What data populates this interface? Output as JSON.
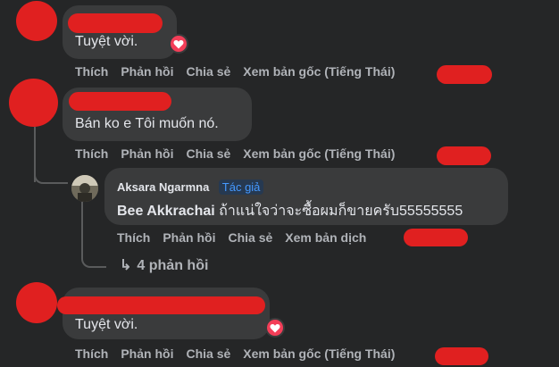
{
  "actions": {
    "like": "Thích",
    "reply": "Phản hồi",
    "share": "Chia sẻ",
    "see_original": "Xem bản gốc (Tiếng Thái)",
    "see_translation": "Xem bản dịch"
  },
  "comments": [
    {
      "text": "Tuyệt vời."
    },
    {
      "text": "Bán ko e Tôi muốn nó."
    },
    {
      "text": "Tuyệt vời."
    }
  ],
  "reply": {
    "author": "Aksara Ngarmna",
    "badge": "Tác giả",
    "mention": "Bee Akkrachai",
    "text": " ถ้าแน่ใจว่าจะซื้อผมก็ขายครับ55555555"
  },
  "replies_link": {
    "arrow": "↳",
    "label": "4 phản hồi"
  },
  "colors": {
    "background": "#252627",
    "bubble": "#3a3b3c",
    "heart": "#f33e58",
    "badge_text": "#4599ff",
    "redaction": "#e02020"
  }
}
